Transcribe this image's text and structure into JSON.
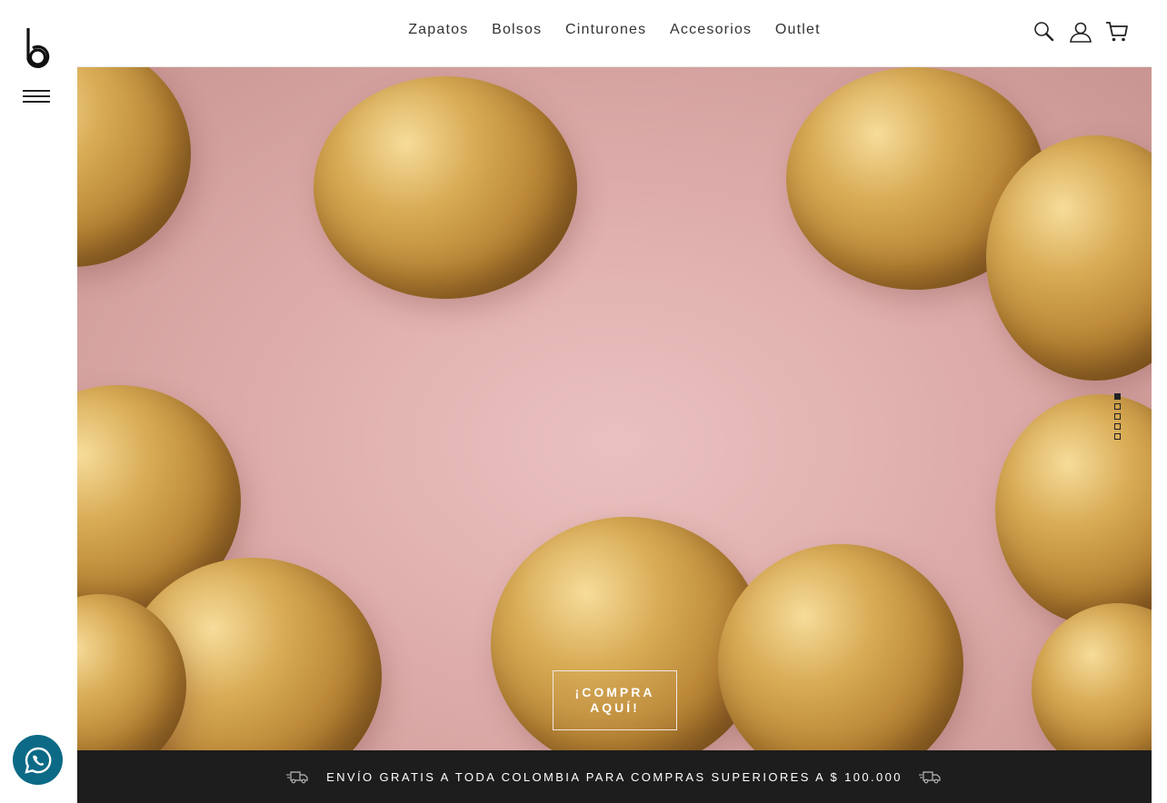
{
  "brand": {
    "logo_icon": "b-logo-icon"
  },
  "nav": {
    "items": [
      {
        "label": "Zapatos"
      },
      {
        "label": "Bolsos"
      },
      {
        "label": "Cinturones"
      },
      {
        "label": "Accesorios"
      },
      {
        "label": "Outlet"
      }
    ]
  },
  "header_icons": [
    "search-icon",
    "user-icon",
    "cart-icon"
  ],
  "hero": {
    "cta_label": "¡COMPRA AQUÍ!",
    "slides_total": 5,
    "active_slide": 1
  },
  "promo": {
    "text": "ENVÍO GRATIS A TODA COLOMBIA PARA COMPRAS SUPERIORES A $ 100.000"
  },
  "floating": {
    "whatsapp_icon": "whatsapp-icon"
  },
  "colors": {
    "accent_dark": "#1d1d1d",
    "whatsapp": "#0c6a86",
    "hero_bg": "#e6b9b7"
  }
}
